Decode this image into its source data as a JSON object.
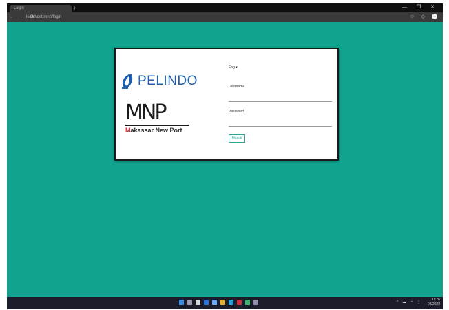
{
  "browser": {
    "tab_title": "Login",
    "new_tab_label": "+",
    "url": "localhost/mnp/login",
    "window_controls": "— ❐ ✕",
    "nav_icons": "← → ⟳"
  },
  "card": {
    "brand_pelindo": "PELINDO",
    "brand_mnp": "MNP",
    "brand_mnp_sub_prefix": "M",
    "brand_mnp_sub_rest": "akassar New Port",
    "language_selector": "Eng",
    "username_label": "Username",
    "password_label": "Password",
    "login_button": "Masuk"
  },
  "taskbar": {
    "tray_icons": "^ ☁ ◔ ⋮",
    "clock_time": "11:26",
    "clock_date": "08/2022"
  },
  "colors": {
    "background": "#12a38f",
    "accent": "#29a99a",
    "pelindo_blue": "#1f5fae",
    "mnp_red": "#d1242f"
  }
}
